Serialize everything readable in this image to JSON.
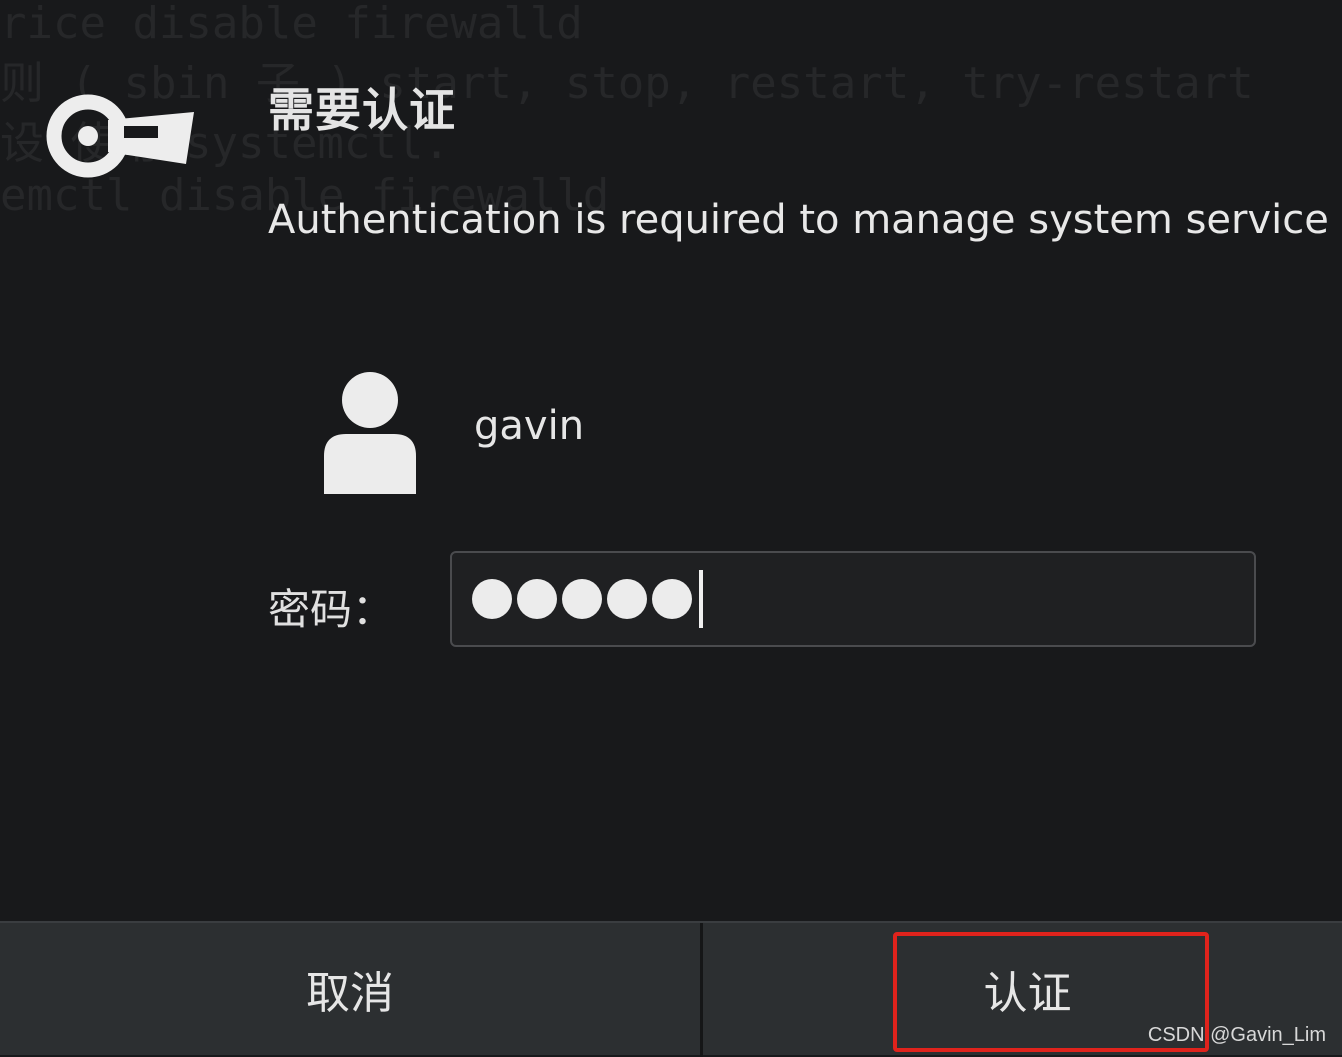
{
  "background_terminal": {
    "lines": [
      "rice disable firewalld",
      "则 ( sbin 子 ) start, stop, restart, try-restart",
      "设 使用 systemctl.",
      "emctl disable firewalld"
    ]
  },
  "dialog": {
    "title": "需要认证",
    "message": "Authentication is required to manage system service ⋯",
    "icon": "key-icon",
    "user": {
      "name": "gavin",
      "avatar_icon": "user-avatar-icon"
    },
    "password": {
      "label": "密码：",
      "masked_length": 5
    }
  },
  "buttons": {
    "cancel_label": "取消",
    "authenticate_label": "认证"
  },
  "annotation": {
    "highlight_color": "#e0231c"
  },
  "watermark": "CSDN @Gavin_Lim",
  "colors": {
    "background": "#18191b",
    "footer": "#2c2f31",
    "text": "#e6e6e6"
  }
}
